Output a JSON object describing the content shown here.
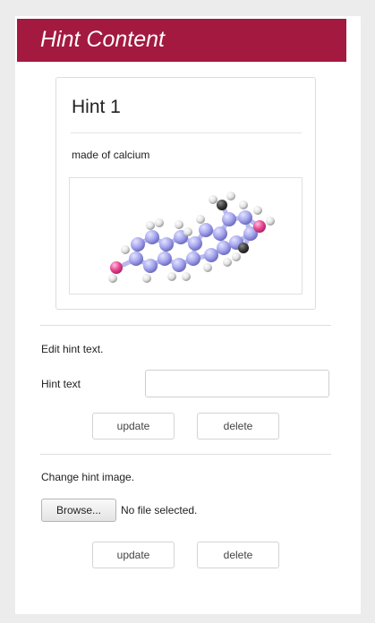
{
  "header": {
    "title": "Hint Content"
  },
  "hint": {
    "title": "Hint 1",
    "text": "made of calcium",
    "image_icon": "molecule-ball-and-stick"
  },
  "edit_text": {
    "section_label": "Edit hint text.",
    "field_label": "Hint text",
    "field_value": "",
    "field_placeholder": "",
    "update_label": "update",
    "delete_label": "delete"
  },
  "edit_image": {
    "section_label": "Change hint image.",
    "browse_label": "Browse...",
    "file_status": "No file selected.",
    "update_label": "update",
    "delete_label": "delete"
  },
  "colors": {
    "header_bg": "#a3193f",
    "page_bg": "#ececec",
    "atom_carbon": "#a9a9f0",
    "atom_hydrogen": "#e8e8e8",
    "atom_oxygen": "#ea4b96"
  }
}
